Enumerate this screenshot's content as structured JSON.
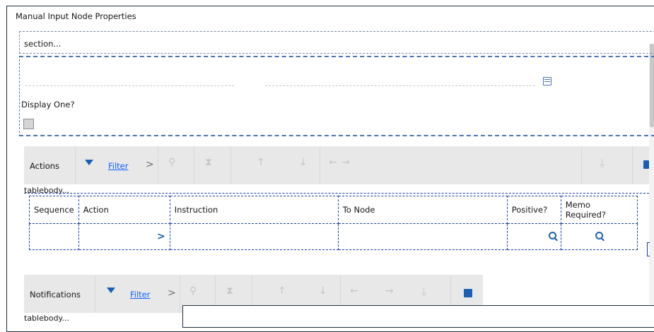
{
  "window": {
    "title": "Manual Input Node Properties"
  },
  "section": {
    "label": "section..."
  },
  "form": {
    "display_one_label": "Display One?",
    "display_one_checked": false
  },
  "actions_toolbar": {
    "label": "Actions",
    "filter_label": "Filter",
    "chevron": ">",
    "arrow_up": "↑",
    "arrow_down": "↓",
    "arrow_left": "←",
    "arrow_right": "→"
  },
  "actions_table": {
    "tablebody_label": "tablebody...",
    "columns": [
      "Sequence",
      "Action",
      "Instruction",
      "To Node",
      "Positive?",
      "Memo Required?"
    ],
    "row_chevron": ">"
  },
  "notifications_toolbar": {
    "label": "Notifications",
    "filter_label": "Filter",
    "chevron": ">",
    "arrow_up": "↑",
    "arrow_down": "↓",
    "arrow_left": "←",
    "arrow_right": "→"
  },
  "notifications_table": {
    "tablebody_label": "tablebody..."
  },
  "colors": {
    "accent": "#1a5fb4",
    "link": "#0f62fe",
    "toolbar_bg": "#e8e8e8",
    "dashed_border": "#4a73b8"
  }
}
